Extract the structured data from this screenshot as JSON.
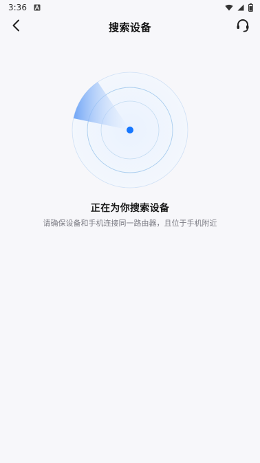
{
  "status_bar": {
    "time": "3:36",
    "notification_icon": "a-icon",
    "right_icons": [
      "wifi-icon",
      "signal-icon",
      "battery-icon"
    ]
  },
  "header": {
    "title": "搜索设备",
    "back_icon": "chevron-left-icon",
    "support_icon": "headset-icon"
  },
  "radar": {
    "accent_color": "#1677ff",
    "ring_color": "#9cc7ef",
    "sweep_color": "#7fb0f6"
  },
  "search": {
    "title": "正在为你搜索设备",
    "subtitle": "请确保设备和手机连接同一路由器，且位于手机附近"
  }
}
